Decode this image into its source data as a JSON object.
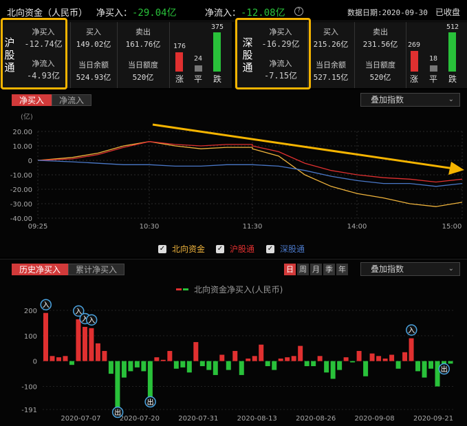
{
  "header": {
    "title": "北向资金（人民币）",
    "net_buy_label": "净买入：",
    "net_buy_value": "-29.04亿",
    "net_inflow_label": "净流入：",
    "net_inflow_value": "-12.08亿",
    "date_label": "数据日期:2020-09-30",
    "status": "已收盘"
  },
  "sh": {
    "name_chars": [
      "沪",
      "股",
      "通"
    ],
    "net_buy_label": "净买入",
    "net_buy": "-12.74亿",
    "net_inflow_label": "净流入",
    "net_inflow": "-4.93亿",
    "buy_label": "买入",
    "buy": "149.02亿",
    "sell_label": "卖出",
    "sell": "161.76亿",
    "balance_label": "当日余额",
    "balance": "524.93亿",
    "quota_label": "当日额度",
    "quota": "520亿",
    "up": "176",
    "flat": "24",
    "down": "375",
    "up_label": "涨",
    "flat_label": "平",
    "down_label": "跌"
  },
  "sz": {
    "name_chars": [
      "深",
      "股",
      "通"
    ],
    "net_buy_label": "净买入",
    "net_buy": "-16.29亿",
    "net_inflow_label": "净流入",
    "net_inflow": "-7.15亿",
    "buy_label": "买入",
    "buy": "215.26亿",
    "sell_label": "卖出",
    "sell": "231.56亿",
    "balance_label": "当日余额",
    "balance": "527.15亿",
    "quota_label": "当日额度",
    "quota": "520亿",
    "up": "269",
    "flat": "18",
    "down": "512",
    "up_label": "涨",
    "flat_label": "平",
    "down_label": "跌"
  },
  "intraday": {
    "tabs": [
      "净买入",
      "净流入"
    ],
    "overlay": "叠加指数",
    "legend": [
      "北向资金",
      "沪股通",
      "深股通"
    ]
  },
  "history": {
    "tabs": [
      "历史净买入",
      "累计净买入"
    ],
    "periods": [
      "日",
      "周",
      "月",
      "季",
      "年"
    ],
    "overlay": "叠加指数",
    "legend_title": "北向资金净买入(人民币)",
    "in_marker": "入",
    "out_marker": "出"
  },
  "colors": {
    "north": "#f0b43c",
    "sh": "#e03030",
    "sz": "#4a78c8",
    "up": "#e03030",
    "down": "#29c13a",
    "arrow": "#f5b400"
  },
  "chart_data": [
    {
      "type": "line",
      "ylabel": "(亿)",
      "ylim": [
        -40,
        20
      ],
      "yticks": [
        "20.00",
        "10.00",
        "0",
        "-10.00",
        "-20.00",
        "-30.00",
        "-40.00"
      ],
      "xticks": [
        "09:25",
        "10:30",
        "11:30",
        "14:00",
        "15:00"
      ],
      "grid": true,
      "x": [
        "09:25",
        "09:45",
        "10:00",
        "10:15",
        "10:30",
        "10:45",
        "11:00",
        "11:15",
        "11:30",
        "13:00",
        "13:15",
        "13:30",
        "13:45",
        "14:00",
        "14:15",
        "14:30",
        "14:45",
        "15:00"
      ],
      "series": [
        {
          "name": "北向资金",
          "values": [
            0,
            2,
            5,
            10,
            13,
            10,
            8,
            9,
            9,
            8,
            3,
            -10,
            -18,
            -23,
            -26,
            -30,
            -32,
            -29
          ]
        },
        {
          "name": "沪股通",
          "values": [
            0,
            1,
            4,
            9,
            13,
            11,
            10,
            11,
            11,
            10,
            6,
            -2,
            -7,
            -10,
            -12,
            -13,
            -15,
            -13
          ]
        },
        {
          "name": "深股通",
          "values": [
            0,
            -1,
            -2,
            -3,
            -3,
            -4,
            -4,
            -3,
            -3,
            -3,
            -4,
            -7,
            -11,
            -14,
            -16,
            -16,
            -18,
            -16
          ]
        }
      ]
    },
    {
      "type": "bar",
      "title": "北向资金净买入(人民币)",
      "ylim": [
        -191,
        230
      ],
      "yticks": [
        "200",
        "100",
        "0",
        "-100",
        "-191"
      ],
      "xticks": [
        "2020-07-07",
        "2020-07-20",
        "2020-07-31",
        "2020-08-13",
        "2020-08-26",
        "2020-09-08",
        "2020-09-21"
      ],
      "values": [
        190,
        20,
        15,
        20,
        -15,
        165,
        135,
        130,
        70,
        40,
        -50,
        -191,
        -65,
        -40,
        -25,
        -40,
        -150,
        15,
        5,
        40,
        -30,
        -25,
        -45,
        75,
        -20,
        -35,
        -55,
        25,
        -35,
        40,
        -55,
        10,
        20,
        65,
        -20,
        -35,
        10,
        15,
        20,
        60,
        -20,
        -20,
        20,
        -45,
        -70,
        -35,
        15,
        -5,
        40,
        -60,
        30,
        20,
        10,
        25,
        -30,
        35,
        90,
        -40,
        -65,
        -30,
        -100,
        -20,
        -10
      ]
    }
  ]
}
